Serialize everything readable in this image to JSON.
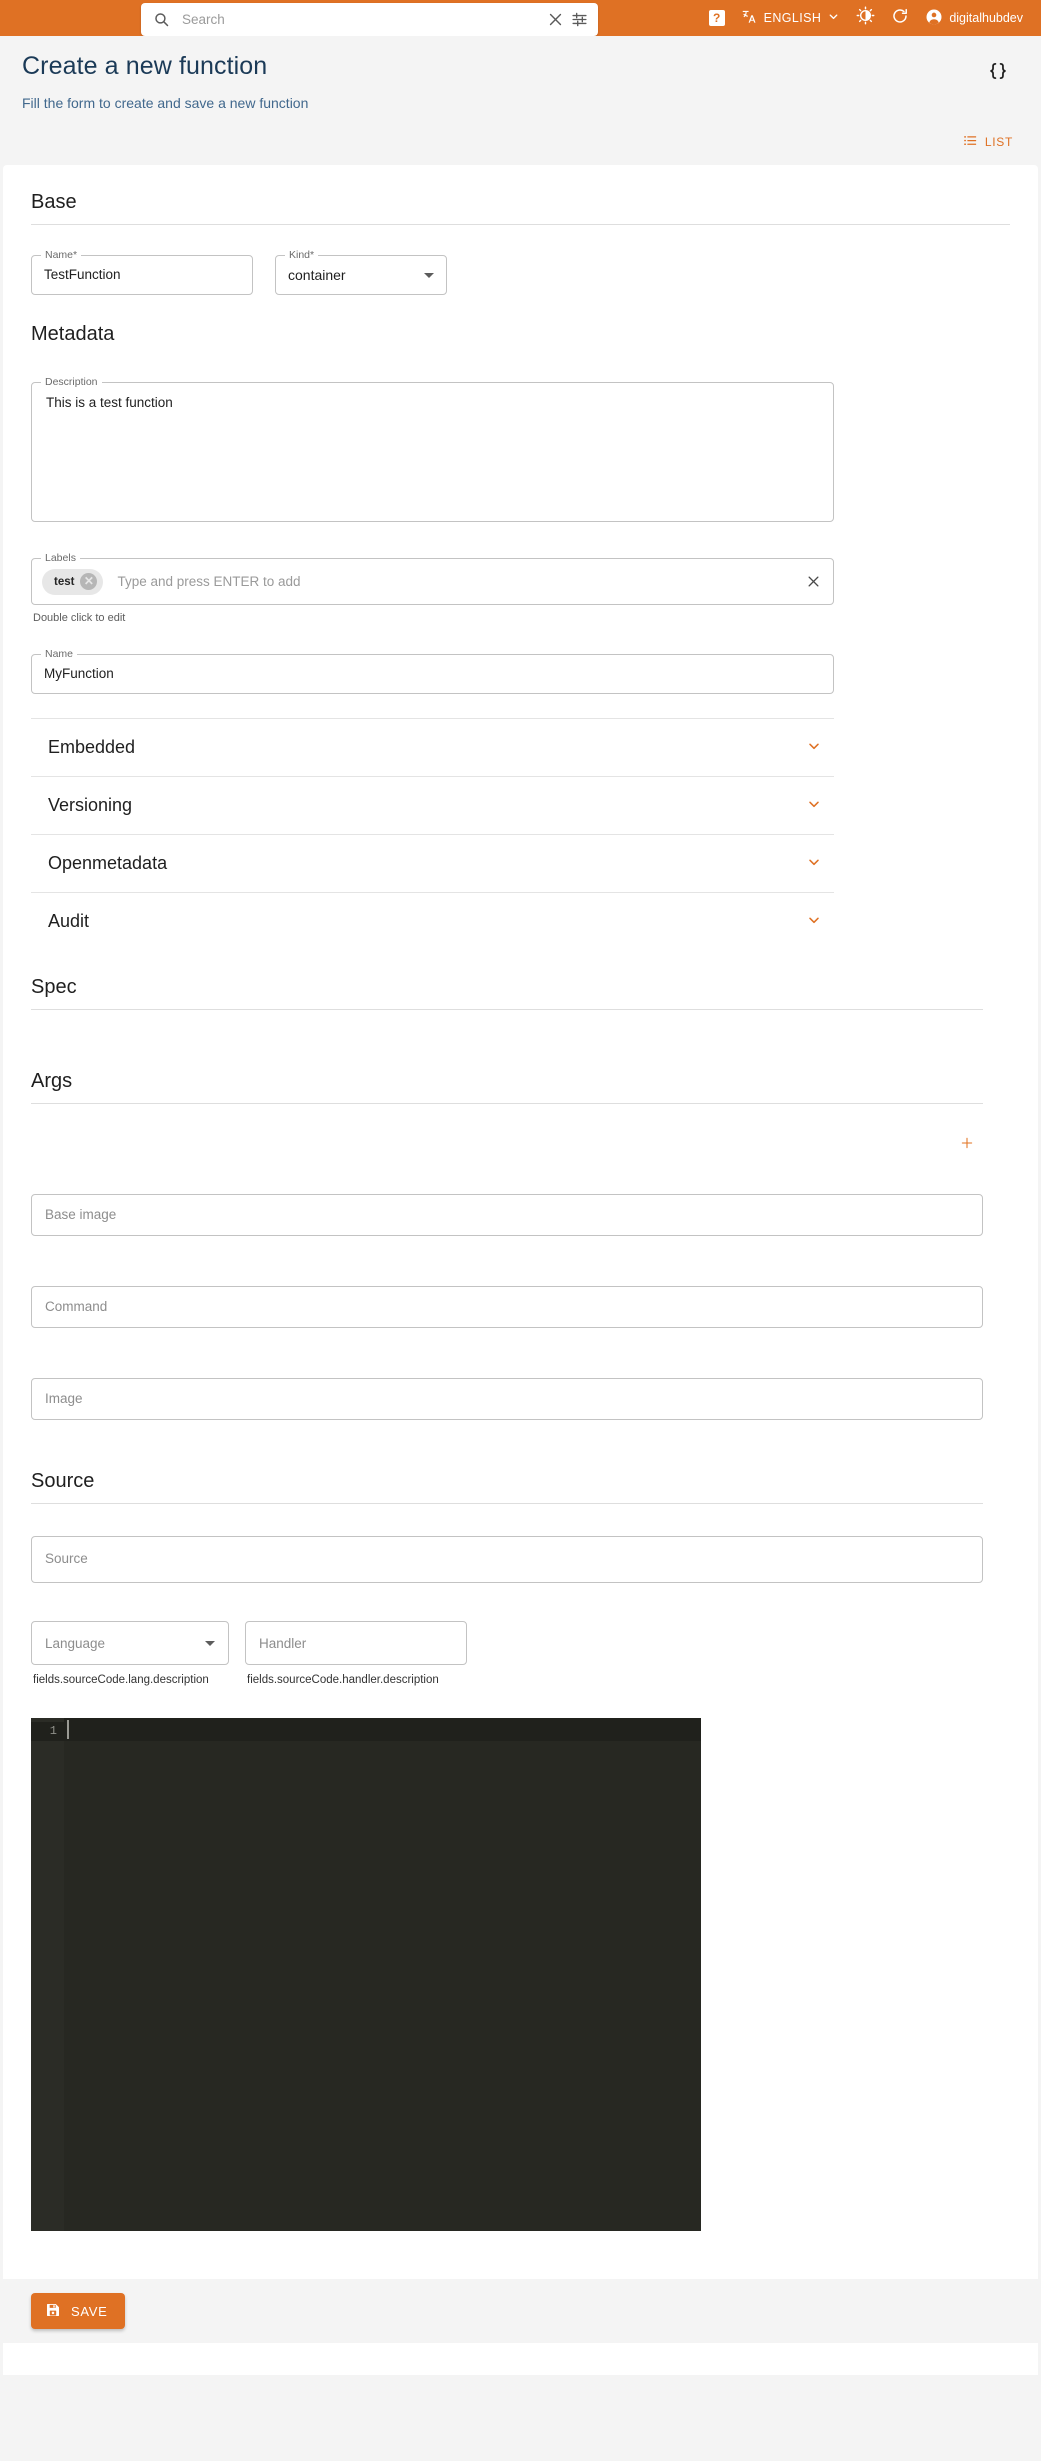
{
  "appbar": {
    "search": {
      "placeholder": "Search",
      "value": "",
      "icon": "search-icon",
      "clear_icon": "close-icon",
      "filter_icon": "tune-icon"
    },
    "help_label": "?",
    "language": {
      "label": "ENGLISH",
      "icon": "translate-icon",
      "chevron": "chevron-down-icon"
    },
    "theme_toggle_icon": "brightness-contrast-icon",
    "refresh_icon": "refresh-icon",
    "user": {
      "name": "digitalhubdev",
      "icon": "account-circle-icon"
    },
    "accent_color": "#df7124"
  },
  "page": {
    "title": "Create a new function",
    "subtitle": "Fill the form to create and save a new function",
    "code_toggle_icon": "braces-icon",
    "list_button": {
      "label": "LIST",
      "icon": "list-icon"
    }
  },
  "base": {
    "section_title": "Base",
    "name": {
      "legend": "Name",
      "required": "*",
      "value": "TestFunction"
    },
    "kind": {
      "legend": "Kind",
      "required": "*",
      "value": "container",
      "icon": "chevron-down-icon"
    }
  },
  "metadata": {
    "section_title": "Metadata",
    "description": {
      "legend": "Description",
      "value": "This is a test function"
    },
    "labels": {
      "legend": "Labels",
      "chips": [
        "test"
      ],
      "placeholder": "Type and press ENTER to add",
      "helper": "Double click to edit",
      "chip_remove_icon": "close-circle-icon",
      "clear_icon": "close-icon"
    },
    "name": {
      "legend": "Name",
      "value": "MyFunction"
    },
    "accordions": [
      {
        "label": "Embedded",
        "icon": "chevron-down-icon"
      },
      {
        "label": "Versioning",
        "icon": "chevron-down-icon"
      },
      {
        "label": "Openmetadata",
        "icon": "chevron-down-icon"
      },
      {
        "label": "Audit",
        "icon": "chevron-down-icon"
      }
    ]
  },
  "spec": {
    "section_title": "Spec",
    "args": {
      "section_title": "Args",
      "add_label": "+",
      "add_icon": "plus-icon"
    },
    "base_image": {
      "placeholder": "Base image",
      "value": ""
    },
    "command": {
      "placeholder": "Command",
      "value": ""
    },
    "image": {
      "placeholder": "Image",
      "value": ""
    }
  },
  "source": {
    "section_title": "Source",
    "source_field": {
      "placeholder": "Source",
      "value": ""
    },
    "language": {
      "placeholder": "Language",
      "value": "",
      "icon": "chevron-down-icon"
    },
    "handler": {
      "placeholder": "Handler",
      "value": ""
    },
    "language_helper": "fields.sourceCode.lang.description",
    "handler_helper": "fields.sourceCode.handler.description",
    "editor": {
      "line_numbers": [
        "1"
      ],
      "content": ""
    }
  },
  "footer": {
    "save": {
      "label": "SAVE",
      "icon": "save-icon"
    }
  }
}
